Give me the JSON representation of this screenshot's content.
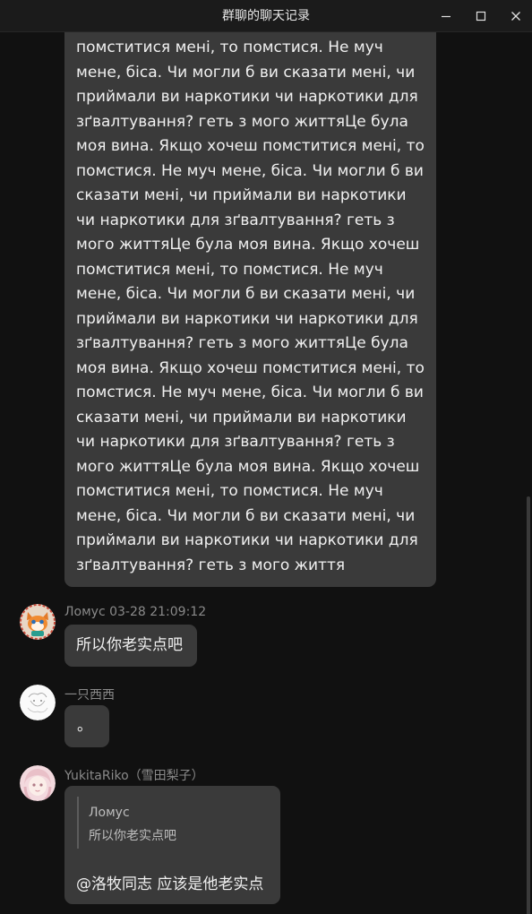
{
  "window": {
    "title": "群聊的聊天记录",
    "controls": [
      "minimize-icon",
      "maximize-icon",
      "close-icon"
    ]
  },
  "messages": [
    {
      "type": "text",
      "text": "помститися мені, то помстися. Не муч мене, біса. Чи могли б ви сказати мені, чи приймали ви наркотики чи наркотики для зґвалтування? геть з мого життяЦе була моя вина. Якщо хочеш помститися мені, то помстися. Не муч мене, біса. Чи могли б ви сказати мені, чи приймали ви наркотики чи наркотики для зґвалтування? геть з мого життяЦе була моя вина. Якщо хочеш помститися мені, то помстися. Не муч мене, біса. Чи могли б ви сказати мені, чи приймали ви наркотики чи наркотики для зґвалтування? геть з мого життяЦе була моя вина. Якщо хочеш помститися мені, то помстися. Не муч мене, біса. Чи могли б ви сказати мені, чи приймали ви наркотики чи наркотики для зґвалтування? геть з мого життяЦе була моя вина. Якщо хочеш помститися мені, то помстися. Не муч мене, біса. Чи могли б ви сказати мені, чи приймали ви наркотики чи наркотики для зґвалтування? геть з мого життя"
    },
    {
      "sender": "Ломус 03-28 21:09:12",
      "avatar": "fox-avatar",
      "text": "所以你老实点吧"
    },
    {
      "sender": "一只西西",
      "avatar": "sketch-avatar",
      "text": "。"
    },
    {
      "sender": "YukitaRiko（雪田梨子）",
      "avatar": "anime-girl-avatar",
      "quote": {
        "name": "Ломус",
        "text": "所以你老实点吧"
      },
      "text": "@洛牧同志 应该是他老实点"
    }
  ],
  "colors": {
    "background": "#111111",
    "titlebar": "#1b1b1b",
    "bubble": "#3a3a3a",
    "text": "#f0f0f0",
    "muted": "#8a8a8a"
  }
}
